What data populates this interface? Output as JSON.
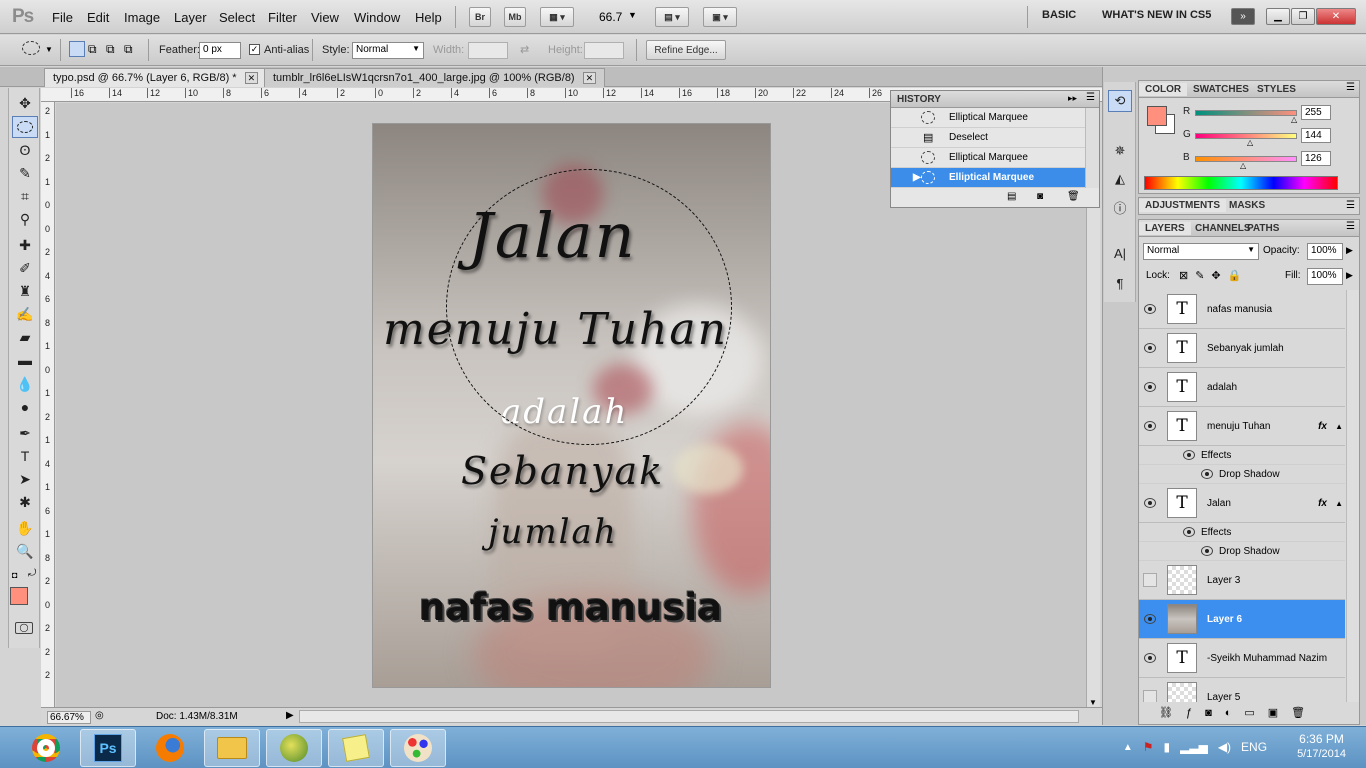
{
  "app": {
    "logo": "Ps"
  },
  "menu": [
    "File",
    "Edit",
    "Image",
    "Layer",
    "Select",
    "Filter",
    "View",
    "Window",
    "Help"
  ],
  "appbar": {
    "bridge": "Br",
    "minibridge": "Mb",
    "zoom": "66.7"
  },
  "workspace": {
    "basic": "BASIC",
    "whatsnew": "WHAT'S NEW IN CS5",
    "more": "»"
  },
  "options": {
    "feather_label": "Feather:",
    "feather_value": "0 px",
    "antialias_label": "Anti-alias",
    "style_label": "Style:",
    "style_value": "Normal",
    "width_label": "Width:",
    "height_label": "Height:",
    "refine_edge": "Refine Edge..."
  },
  "tabs": [
    {
      "label": "typo.psd @ 66.7% (Layer 6, RGB/8) *"
    },
    {
      "label": "tumblr_lr6l6eLIsW1qcrsn7o1_400_large.jpg @ 100% (RGB/8)"
    }
  ],
  "ruler_top": [
    "16",
    "14",
    "12",
    "10",
    "8",
    "6",
    "4",
    "2",
    "0",
    "2",
    "4",
    "6",
    "8",
    "10",
    "12",
    "14",
    "16",
    "18",
    "20",
    "22",
    "24",
    "26"
  ],
  "ruler_left": [
    "2",
    "1",
    "2",
    "1",
    "0",
    "0",
    "2",
    "4",
    "6",
    "8",
    "1",
    "0",
    "1",
    "2",
    "1",
    "4",
    "1",
    "6",
    "1",
    "8",
    "2",
    "0",
    "2",
    "2",
    "2"
  ],
  "canvas_text": {
    "line1": "Jalan",
    "line2": "menuju Tuhan",
    "line3": "adalah",
    "line4": "Sebanyak",
    "line5": "jumlah",
    "line6": "nafas manusia"
  },
  "status": {
    "zoom": "66.67%",
    "doc": "Doc: 1.43M/8.31M"
  },
  "history": {
    "title": "HISTORY",
    "items": [
      {
        "label": "Elliptical Marquee",
        "selected": false
      },
      {
        "label": "Deselect",
        "selected": false
      },
      {
        "label": "Elliptical Marquee",
        "selected": false
      },
      {
        "label": "Elliptical Marquee",
        "selected": true
      }
    ]
  },
  "color_panel": {
    "tabs": [
      "COLOR",
      "SWATCHES",
      "STYLES"
    ],
    "r_label": "R",
    "g_label": "G",
    "b_label": "B",
    "r": "255",
    "g": "144",
    "b": "126",
    "foreground": "#ff907e"
  },
  "adjust_tabs": [
    "ADJUSTMENTS",
    "MASKS"
  ],
  "layers_panel": {
    "tabs": [
      "LAYERS",
      "CHANNELS",
      "PATHS"
    ],
    "blend_mode": "Normal",
    "opacity_label": "Opacity:",
    "opacity": "100%",
    "lock_label": "Lock:",
    "fill_label": "Fill:",
    "fill": "100%",
    "effects_label": "Effects",
    "drop_shadow_label": "Drop Shadow",
    "fx_label": "fx",
    "layers": [
      {
        "name": "nafas manusia",
        "type": "text",
        "visible": true
      },
      {
        "name": "Sebanyak  jumlah",
        "type": "text",
        "visible": true
      },
      {
        "name": "adalah",
        "type": "text",
        "visible": true
      },
      {
        "name": "menuju Tuhan",
        "type": "text",
        "visible": true,
        "fx": true
      },
      {
        "name": "Jalan",
        "type": "text",
        "visible": true,
        "fx": true
      },
      {
        "name": "Layer 3",
        "type": "pixel",
        "visible": false
      },
      {
        "name": "Layer 6",
        "type": "image",
        "visible": true,
        "selected": true
      },
      {
        "name": "-Syeikh Muhammad Nazim",
        "type": "text",
        "visible": true
      },
      {
        "name": "Layer 5",
        "type": "pixel",
        "visible": false
      }
    ]
  },
  "taskbar": {
    "apps": [
      "chrome-icon",
      "photoshop-icon",
      "firefox-icon",
      "explorer-icon",
      "globe-icon",
      "sticky-notes-icon",
      "paint-icon"
    ],
    "lang": "ENG",
    "time": "6:36 PM",
    "date": "5/17/2014"
  }
}
